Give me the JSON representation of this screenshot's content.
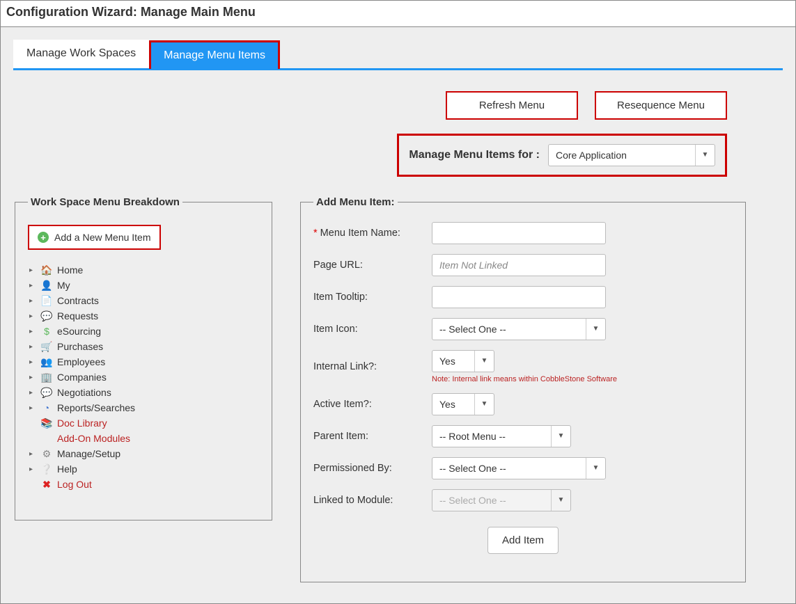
{
  "page_title": "Configuration Wizard: Manage Main Menu",
  "tabs": [
    {
      "label": "Manage Work Spaces",
      "active": false
    },
    {
      "label": "Manage Menu Items",
      "active": true
    }
  ],
  "actions": {
    "refresh": "Refresh Menu",
    "resequence": "Resequence Menu"
  },
  "selector": {
    "label": "Manage Menu Items for :",
    "value": "Core Application"
  },
  "left_panel": {
    "legend": "Work Space Menu Breakdown",
    "add_button": "Add a New Menu Item",
    "tree": [
      {
        "label": "Home",
        "expandable": true,
        "icon": "🏠",
        "cls": "ic-home"
      },
      {
        "label": "My",
        "expandable": true,
        "icon": "👤",
        "cls": "ic-user"
      },
      {
        "label": "Contracts",
        "expandable": true,
        "icon": "📄",
        "cls": "ic-doc"
      },
      {
        "label": "Requests",
        "expandable": true,
        "icon": "💬",
        "cls": "ic-chat"
      },
      {
        "label": "eSourcing",
        "expandable": true,
        "icon": "$",
        "cls": "ic-src"
      },
      {
        "label": "Purchases",
        "expandable": true,
        "icon": "🛒",
        "cls": "ic-cart"
      },
      {
        "label": "Employees",
        "expandable": true,
        "icon": "👥",
        "cls": "ic-people"
      },
      {
        "label": "Companies",
        "expandable": true,
        "icon": "🏢",
        "cls": "ic-build"
      },
      {
        "label": "Negotiations",
        "expandable": true,
        "icon": "💬",
        "cls": "ic-chat"
      },
      {
        "label": "Reports/Searches",
        "expandable": true,
        "icon": "◔",
        "cls": "ic-pie"
      },
      {
        "label": "Doc Library",
        "expandable": false,
        "icon": "📚",
        "cls": "ic-books",
        "highlight": true
      },
      {
        "label": "Add-On Modules",
        "expandable": false,
        "icon": "",
        "cls": "",
        "highlight": true
      },
      {
        "label": "Manage/Setup",
        "expandable": true,
        "icon": "⚙",
        "cls": "ic-gear"
      },
      {
        "label": "Help",
        "expandable": true,
        "icon": "❔",
        "cls": "ic-help"
      },
      {
        "label": "Log Out",
        "expandable": false,
        "icon": "✖",
        "cls": "ic-x",
        "highlight": true
      }
    ]
  },
  "right_panel": {
    "legend": "Add Menu Item:",
    "fields": {
      "name": {
        "label": "Menu Item Name:",
        "value": "",
        "required": true
      },
      "url": {
        "label": "Page URL:",
        "value": "",
        "placeholder": "Item Not Linked"
      },
      "tooltip": {
        "label": "Item Tooltip:",
        "value": ""
      },
      "icon": {
        "label": "Item Icon:",
        "value": "-- Select One --"
      },
      "internal": {
        "label": "Internal Link?:",
        "value": "Yes",
        "note": "Note: Internal link means within CobbleStone Software"
      },
      "active": {
        "label": "Active Item?:",
        "value": "Yes"
      },
      "parent": {
        "label": "Parent Item:",
        "value": "-- Root Menu --"
      },
      "permission": {
        "label": "Permissioned By:",
        "value": "-- Select One --"
      },
      "module": {
        "label": "Linked to Module:",
        "value": "-- Select One --",
        "disabled": true
      }
    },
    "submit_label": "Add Item"
  }
}
